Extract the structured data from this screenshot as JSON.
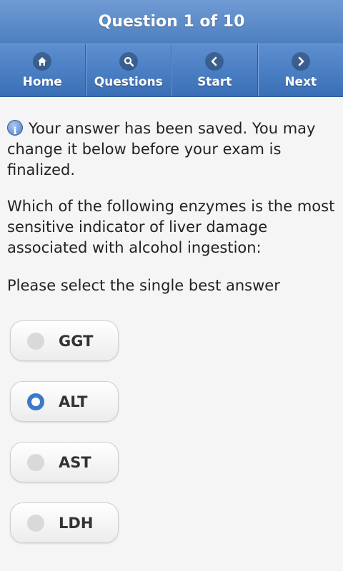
{
  "header": {
    "title": "Question 1 of 10"
  },
  "nav": [
    {
      "label": "Home",
      "icon": "home-icon"
    },
    {
      "label": "Questions",
      "icon": "search-icon"
    },
    {
      "label": "Start",
      "icon": "chevron-left-icon"
    },
    {
      "label": "Next",
      "icon": "chevron-right-icon"
    }
  ],
  "message": "Your answer has been saved. You may change it below before your exam is finalized.",
  "question": "Which of the following enzymes is the most sensitive indicator of liver damage associated with alcohol ingestion:",
  "instruction": "Please select the single best answer",
  "options": [
    {
      "label": "GGT",
      "selected": false
    },
    {
      "label": "ALT",
      "selected": true
    },
    {
      "label": "AST",
      "selected": false
    },
    {
      "label": "LDH",
      "selected": false
    }
  ],
  "colors": {
    "header": "#5a8acb",
    "selected_radio": "#3b79c9",
    "background": "#f5f5f5"
  }
}
